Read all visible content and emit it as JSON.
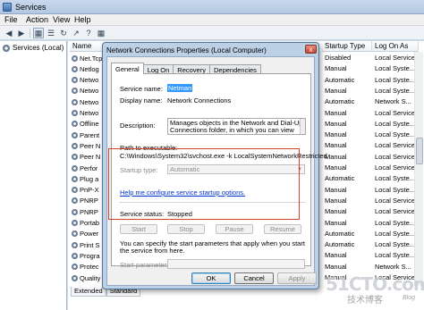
{
  "window": {
    "title": "Services",
    "icon": "services-gear-icon"
  },
  "menu": [
    "File",
    "Action",
    "View",
    "Help"
  ],
  "toolbar_icons": [
    "back-arrow-icon",
    "forward-arrow-icon",
    "console-tree-icon",
    "list-view-icon",
    "refresh-icon",
    "export-icon",
    "help-icon",
    "properties-icon",
    "play-icon",
    "stop-icon",
    "pause-icon",
    "restart-icon"
  ],
  "tree": {
    "label": "Services (Local)"
  },
  "columns": {
    "name": "Name",
    "startup_type": "Startup Type",
    "log_on_as": "Log On As"
  },
  "rows": [
    {
      "name": "Net.Tcp",
      "startup": "Disabled",
      "logon": "Local Service"
    },
    {
      "name": "Netlog",
      "startup": "Manual",
      "logon": "Local Syste..."
    },
    {
      "name": "Netwo",
      "startup": "Automatic",
      "logon": "Local Syste..."
    },
    {
      "name": "Netwo",
      "startup": "Manual",
      "logon": "Local Syste..."
    },
    {
      "name": "Netwo",
      "startup": "Automatic",
      "logon": "Network S..."
    },
    {
      "name": "Netwo",
      "startup": "Manual",
      "logon": "Local Service"
    },
    {
      "name": "Offline",
      "startup": "Manual",
      "logon": "Local Syste..."
    },
    {
      "name": "Parent",
      "startup": "Manual",
      "logon": "Local Syste..."
    },
    {
      "name": "Peer N",
      "startup": "Manual",
      "logon": "Local Service"
    },
    {
      "name": "Peer N",
      "startup": "Manual",
      "logon": "Local Service"
    },
    {
      "name": "Perfor",
      "startup": "Manual",
      "logon": "Local Service"
    },
    {
      "name": "Plug a",
      "startup": "Automatic",
      "logon": "Local Syste..."
    },
    {
      "name": "PnP-X",
      "startup": "Manual",
      "logon": "Local Syste..."
    },
    {
      "name": "PNRP",
      "startup": "Manual",
      "logon": "Local Service"
    },
    {
      "name": "PNRP",
      "startup": "Manual",
      "logon": "Local Service"
    },
    {
      "name": "Portab",
      "startup": "Manual",
      "logon": "Local Syste..."
    },
    {
      "name": "Power",
      "startup": "Automatic",
      "logon": "Local Syste..."
    },
    {
      "name": "Print S",
      "startup": "Automatic",
      "logon": "Local Syste..."
    },
    {
      "name": "Progra",
      "startup": "Manual",
      "logon": "Local Syste..."
    },
    {
      "name": "Protec",
      "startup": "Manual",
      "logon": "Network S..."
    },
    {
      "name": "Quality",
      "startup": "Manual",
      "logon": "Local Service"
    }
  ],
  "view_tabs": [
    "Extended",
    "Standard"
  ],
  "dialog": {
    "title": "Network Connections Properties (Local Computer)",
    "close": "x",
    "tabs": [
      "General",
      "Log On",
      "Recovery",
      "Dependencies"
    ],
    "service_name_label": "Service name:",
    "service_name": "Netman",
    "display_name_label": "Display name:",
    "display_name": "Network Connections",
    "description_label": "Description:",
    "description": "Manages objects in the Network and Dial-Up Connections folder, in which you can view both local",
    "path_label": "Path to executable:",
    "path": "C:\\Windows\\System32\\svchost.exe -k LocalSystemNetworkRestricted",
    "startup_type_label": "Startup type:",
    "startup_type": "Automatic",
    "help_link": "Help me configure service startup options.",
    "status_label": "Service status:",
    "status": "Stopped",
    "buttons": {
      "start": "Start",
      "stop": "Stop",
      "pause": "Pause",
      "resume": "Resume"
    },
    "params_note": "You can specify the start parameters that apply when you start the service from here.",
    "params_label": "Start parameters:",
    "params_value": "",
    "ok": "OK",
    "cancel": "Cancel",
    "apply": "Apply"
  },
  "watermark": {
    "main": "51CTO.com",
    "sub": "技术博客",
    "blog": "Blog"
  }
}
